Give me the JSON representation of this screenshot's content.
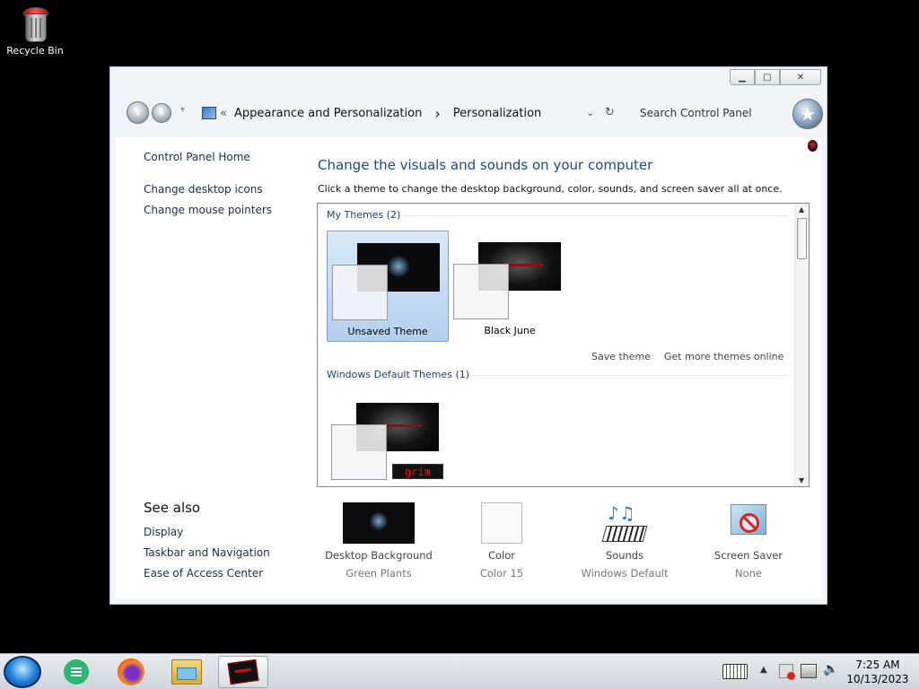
{
  "desktop": {
    "recycle_bin_label": "Recycle Bin"
  },
  "window": {
    "controls": {
      "minimize": "▁",
      "maximize": "▢",
      "close": "✕"
    },
    "breadcrumb": {
      "overflow": "«",
      "items": [
        "Appearance and Personalization",
        "Personalization"
      ],
      "separator": "›"
    },
    "search_placeholder": "Search Control Panel",
    "left_nav": {
      "home": "Control Panel Home",
      "links": [
        "Change desktop icons",
        "Change mouse pointers"
      ],
      "see_also_heading": "See also",
      "see_also": [
        "Display",
        "Taskbar and Navigation",
        "Ease of Access Center"
      ]
    },
    "main": {
      "title": "Change the visuals and sounds on your computer",
      "description": "Click a theme to change the desktop background, color, sounds, and screen saver all at once.",
      "my_themes_heading": "My Themes (2)",
      "my_themes": [
        {
          "name": "Unsaved Theme",
          "selected": true
        },
        {
          "name": "Black June",
          "selected": false
        }
      ],
      "save_theme": "Save theme",
      "get_more": "Get more themes online",
      "default_heading": "Windows Default Themes (1)",
      "default_theme_badge": "grim"
    },
    "bottom": [
      {
        "label": "Desktop Background",
        "value": "Green Plants",
        "icon": "desktop-background-icon"
      },
      {
        "label": "Color",
        "value": "Color 15",
        "icon": "color-icon"
      },
      {
        "label": "Sounds",
        "value": "Windows Default",
        "icon": "sounds-icon"
      },
      {
        "label": "Screen Saver",
        "value": "None",
        "icon": "screen-saver-icon"
      }
    ]
  },
  "taskbar": {
    "time": "7:25 AM",
    "date": "10/13/2023"
  }
}
